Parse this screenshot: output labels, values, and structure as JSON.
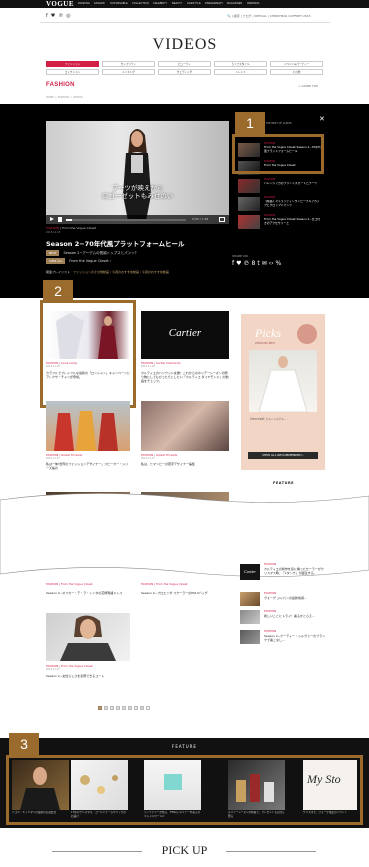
{
  "header": {
    "logo": "VOGUE",
    "nav": [
      "RANKING",
      "FASHION",
      "SUSTAINABLE",
      "COLLECTION",
      "CELEBRITY",
      "BEAUTY",
      "LIFESTYLE",
      "FINEJEWELRY",
      "MAGAZINES",
      "WEDDING"
    ],
    "utility": "🔍 | 検索 | ブログ | SPECIAL | CHRISTMAS COFFRET 2015"
  },
  "page": {
    "title": "VIDEOS",
    "section_title": "FASHION",
    "guide_top": "< GUIDE TOP",
    "breadcrumb": "HOME > FASHION > VIDEOS"
  },
  "subnav_row1": [
    "ファッション",
    "セレブリティ",
    "ビューティ",
    "ライフスタイル",
    "イベント&パーティー"
  ],
  "subnav_row2": [
    "コレクション",
    "メイキング",
    "ウェディング",
    "トレンド",
    "その他"
  ],
  "video": {
    "subtitle_line1": "ブーツが映えから",
    "subtitle_line2": "ロゴーゼットもみせのい",
    "time": "0:00 / 1:26",
    "category": "FASHION",
    "source": "From the Vogue Closet",
    "date": "2015.11.18",
    "title": "Season 2−70年代風プラットフォームヒール",
    "next_tag": "NEXT",
    "next_text": "Season 2−アーデムの長袖トップスとパンツ?",
    "viewall_tag": "VIEW ALL",
    "viewall_text": "From the Vogue Closet ›",
    "playlist_label": "関連プレイリスト",
    "playlist_links": "ファッションのその他動画 / 今週のおすすめ動画 / 今週のおすすめ動画"
  },
  "panel": {
    "head": "SEE THE REST OF ALBUM",
    "items": [
      {
        "cat": "FASHION",
        "text": "From the Vogue Closet Season 2−70年代風プラットフォームヒール"
      },
      {
        "cat": "FASHION",
        "text": "From the Vogue Closet"
      },
      {
        "cat": "FASHION",
        "text": "バレンシアガのプリントスカートとブーツ"
      },
      {
        "cat": "FASHION",
        "text": "【特集】ストラッティンワンピーブルアカップとクロップドパンツ"
      },
      {
        "cat": "FASHION",
        "text": "From the Vogue Closet Season 2−ロゴ付きのアクセサリーと"
      }
    ],
    "share_label": "SHARE ON",
    "share_icons": [
      "f",
      "♥",
      "℗",
      "8",
      "t",
      "✉",
      "‹›",
      "%"
    ]
  },
  "annotations": [
    "1",
    "2",
    "3"
  ],
  "grid": [
    {
      "cat": "FASHION | Louis Camp",
      "date": "2015.11.18",
      "text": "カラフルでプレイフルな最新の「ロンシャン」キャンペーンにアレクサ・チャンが登場。"
    },
    {
      "cat": "FASHION | Cartier Diamonds",
      "date": "2015.11.18",
      "text": "カルティエのハリウッド女優！これからのホリデーシーズンの贈り物にしてもぴったりとしたい「カルティエ ダイヤモンド」の動画をチェック。",
      "logo": "Cartier"
    },
    {
      "cat": "FASHION | Global Threads",
      "date": "2015.11.17",
      "text": "私は一体!世界のファッションデザイナー」スピーカー・シリーズ編の"
    },
    {
      "cat": "FASHION | Global Threads",
      "date": "2015.11.17",
      "text": "私は、ヒマンビーの若手デザイナー編集"
    }
  ],
  "ad": {
    "headline": "Picks",
    "sub": "WEDDING BETA",
    "button": "VIEW ALL RECOMMENDED ›",
    "caption": "【FEATURE】ヒルトンホテル..."
  },
  "feature_right": "FEATURE",
  "lower": [
    {
      "cat": "FASHION | From the Vogue Closet",
      "text": "Season 2−オスカー・デ・ラ・レンタの花柄刺繍ドレス"
    },
    {
      "cat": "FASHION | From the Vogue Closet",
      "text": "Season 2−プロエンザ スクーラーのPS13バッグ"
    },
    {
      "cat": "FASHION | From the Vogue Closet",
      "date": "2015.11.17",
      "text": "Season 2−女性らしさを表現できるコート"
    }
  ],
  "side_list": [
    {
      "cat": "FASHION",
      "text": "カルティエの新作を身に纏ったセーラーがクリスマス時、「Lタンク」が誕生する。"
    },
    {
      "cat": "FASHION",
      "text": "ヴォーグ ジャパンの最新情報..."
    },
    {
      "cat": "FASHION",
      "text": "新しいことにトライ！着るかとらえ..."
    },
    {
      "cat": "FASHION",
      "text": "Season 2−ケーティー・シルヴァーのブランクで着こなし..."
    }
  ],
  "pager": [
    "1",
    "2",
    "3",
    "4",
    "5",
    "6",
    "7",
    "8",
    "›"
  ],
  "feature": {
    "title": "FEATURE",
    "captions": [
      "ニコル・キッドマンの最新の記者会見",
      "17年のクリスマス、ゴールドチームやリックのお届け",
      "ティファニーが贈る、Tiffany ホリデーを彩るスペシャルワールド",
      "ホリデーシーズンの特集で、プレゼントも自分に贈る",
      "クリスマス、ヴォーグ限定のイベント"
    ]
  },
  "pickup": "PICK UP",
  "colors": {
    "accent": "#d21f46",
    "annotation": "#9b6b2e",
    "gold": "#a08057"
  }
}
